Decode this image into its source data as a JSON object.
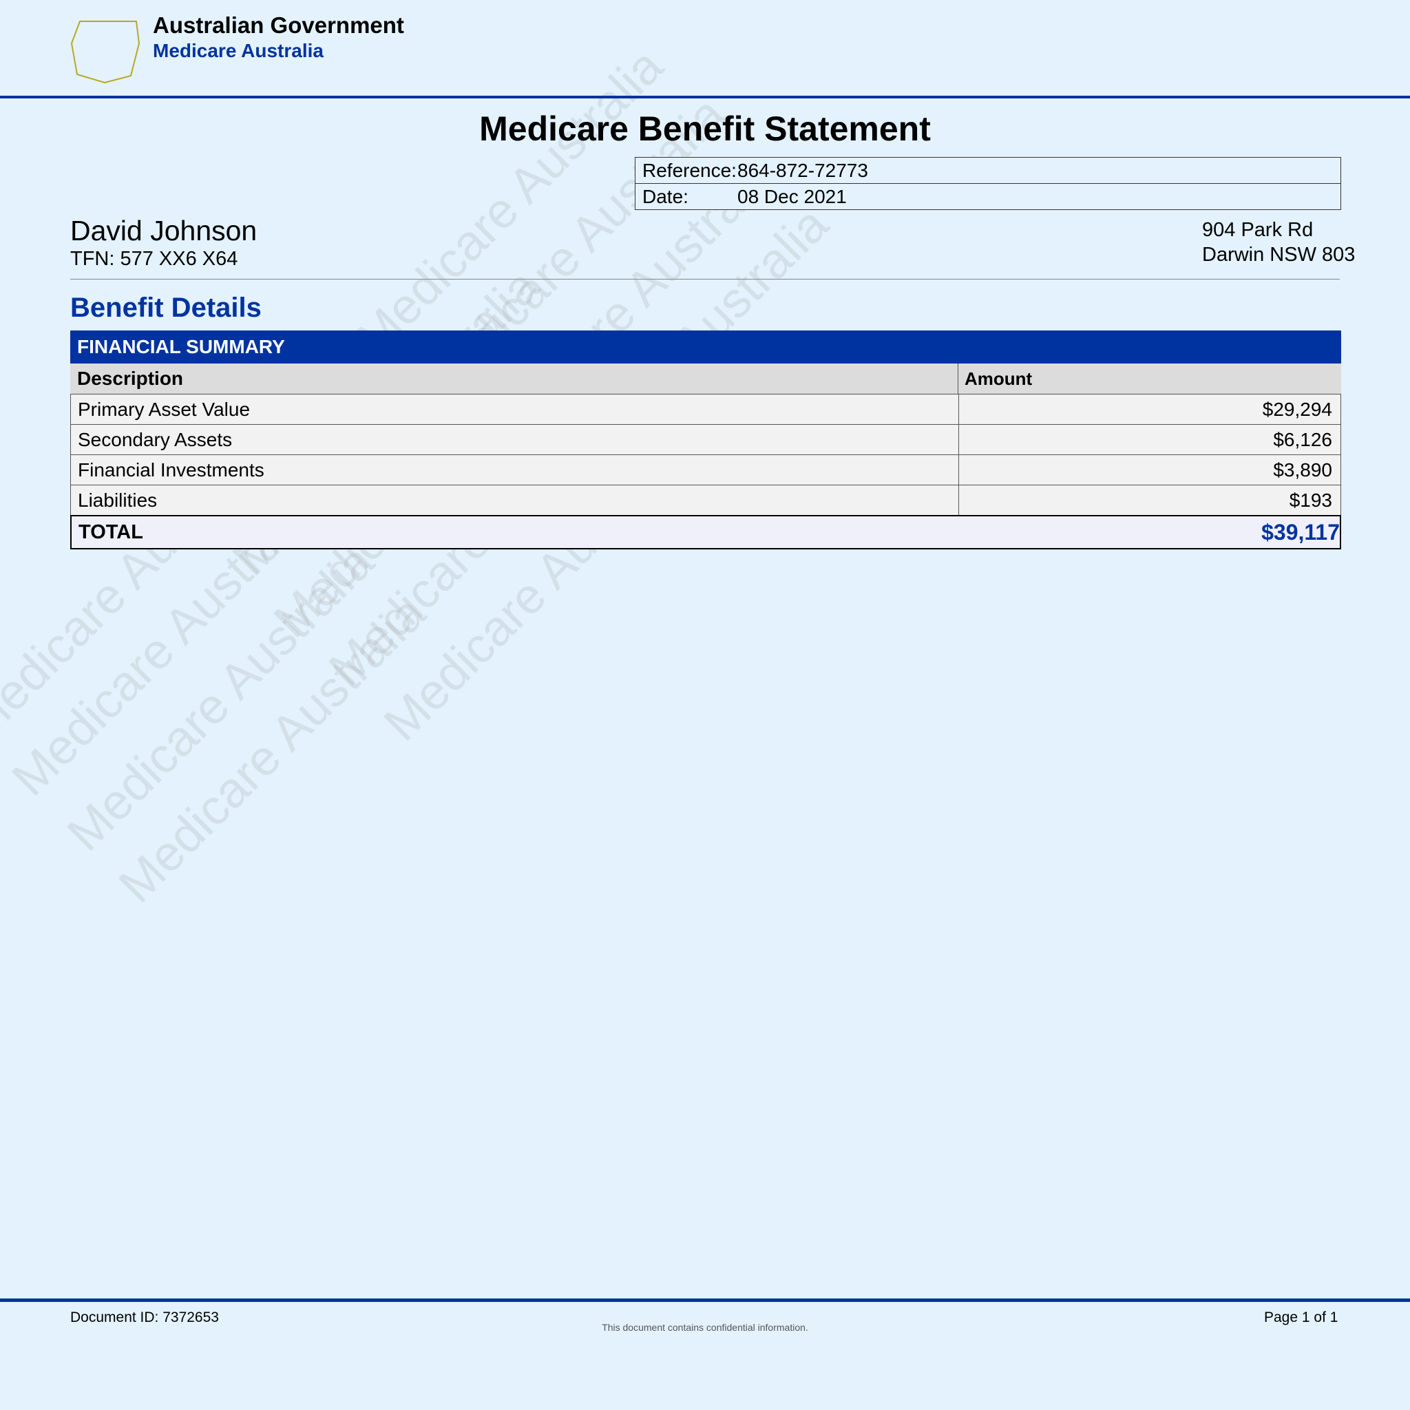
{
  "header": {
    "gov_title": "Australian Government",
    "gov_subtitle": "Medicare Australia",
    "logo_color": "#b8a824"
  },
  "document": {
    "title": "Medicare Benefit Statement",
    "reference_label": "Reference:",
    "reference_value": "864-872-72773",
    "date_label": "Date:",
    "date_value": "08 Dec 2021"
  },
  "patient": {
    "name": "David Johnson",
    "tfn": "TFN: 577 XX6 X64",
    "address_line1": "904 Park Rd",
    "address_line2": "Darwin NSW 803"
  },
  "section": {
    "title": "Benefit Details"
  },
  "table": {
    "banner": "FINANCIAL SUMMARY",
    "headers": {
      "description": "Description",
      "amount": "Amount"
    },
    "rows": [
      {
        "description": "Primary Asset Value",
        "amount": "$29,294"
      },
      {
        "description": "Secondary Assets",
        "amount": "$6,126"
      },
      {
        "description": "Financial Investments",
        "amount": "$3,890"
      },
      {
        "description": "Liabilities",
        "amount": "$193"
      }
    ],
    "total_label": "TOTAL",
    "total_value": "$39,117"
  },
  "watermark": {
    "text": "Medicare Australia"
  },
  "footer": {
    "document_id": "Document ID: 7372653",
    "confidential": "This document contains confidential information.",
    "page": "Page 1 of 1"
  },
  "colors": {
    "accent": "#0033a0",
    "background": "#e3f2fd"
  }
}
